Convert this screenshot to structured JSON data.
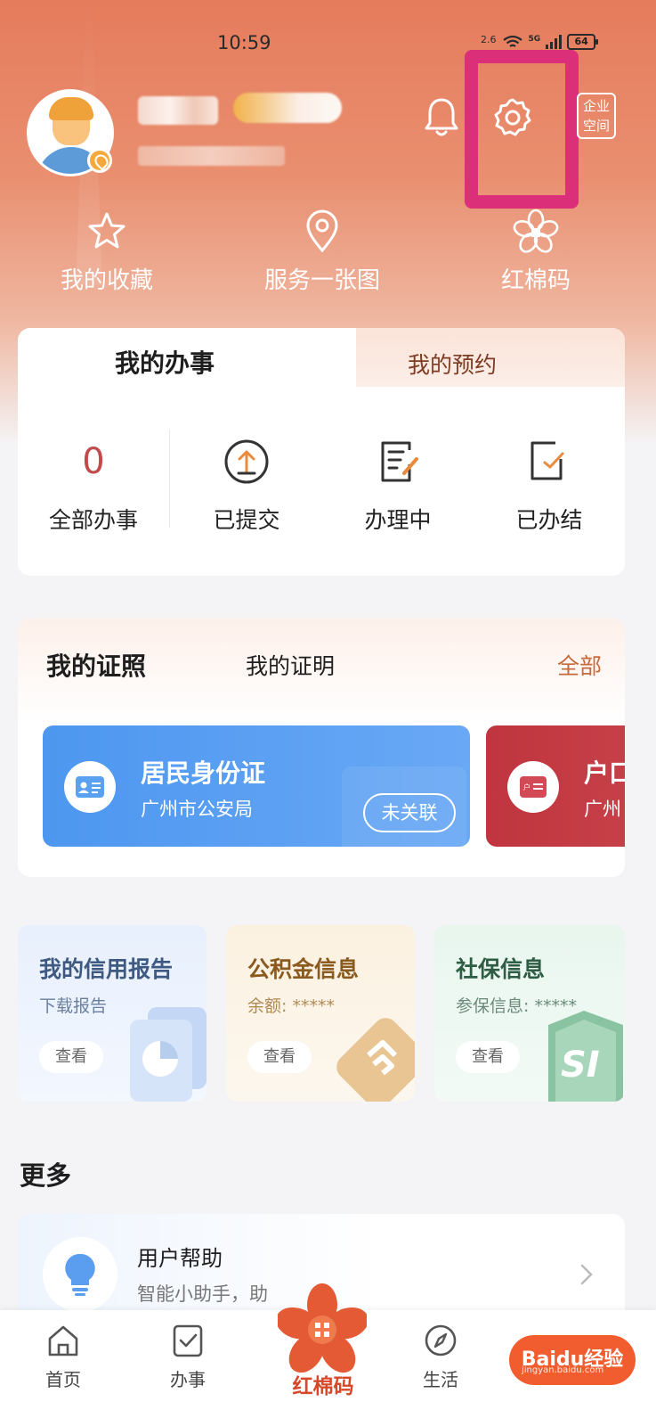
{
  "status": {
    "time": "10:59",
    "speed": "2.6",
    "network": "5G",
    "battery": "64"
  },
  "header": {
    "enterprise_label": "企业空间"
  },
  "quick_actions": [
    {
      "label": "我的收藏",
      "icon": "star-icon"
    },
    {
      "label": "服务一张图",
      "icon": "location-pin-icon"
    },
    {
      "label": "红棉码",
      "icon": "kapok-flower-icon"
    }
  ],
  "affairs": {
    "tab_active": "我的办事",
    "tab_inactive": "我的预约",
    "stats": [
      {
        "value": "0",
        "label": "全部办事"
      },
      {
        "label": "已提交",
        "icon": "upload-circle-icon"
      },
      {
        "label": "办理中",
        "icon": "document-edit-icon"
      },
      {
        "label": "已办结",
        "icon": "check-square-icon"
      }
    ]
  },
  "licenses": {
    "title": "我的证照",
    "tab2": "我的证明",
    "all": "全部",
    "cards": [
      {
        "title": "居民身份证",
        "issuer": "广州市公安局",
        "status": "未关联",
        "color": "#4d97f0"
      },
      {
        "title": "户口",
        "issuer": "广州",
        "color": "#c0353f"
      }
    ]
  },
  "tiles": [
    {
      "title": "我的信用报告",
      "subtitle": "下载报告",
      "button": "查看"
    },
    {
      "title": "公积金信息",
      "subtitle": "余额: *****",
      "button": "查看"
    },
    {
      "title": "社保信息",
      "subtitle": "参保信息: *****",
      "button": "查看",
      "art_text": "SI"
    }
  ],
  "more": {
    "title": "更多",
    "help_title": "用户帮助",
    "help_subtitle": "智能小助手，助"
  },
  "nav": {
    "home": "首页",
    "affairs": "办事",
    "center": "红棉码",
    "life": "生活"
  },
  "watermark": {
    "text": "Baidu经验",
    "sub": "jingyan.baidu.com"
  },
  "colors": {
    "header": "#e57c5c",
    "highlight": "#dc2f7a",
    "brand_red": "#d7482a"
  }
}
